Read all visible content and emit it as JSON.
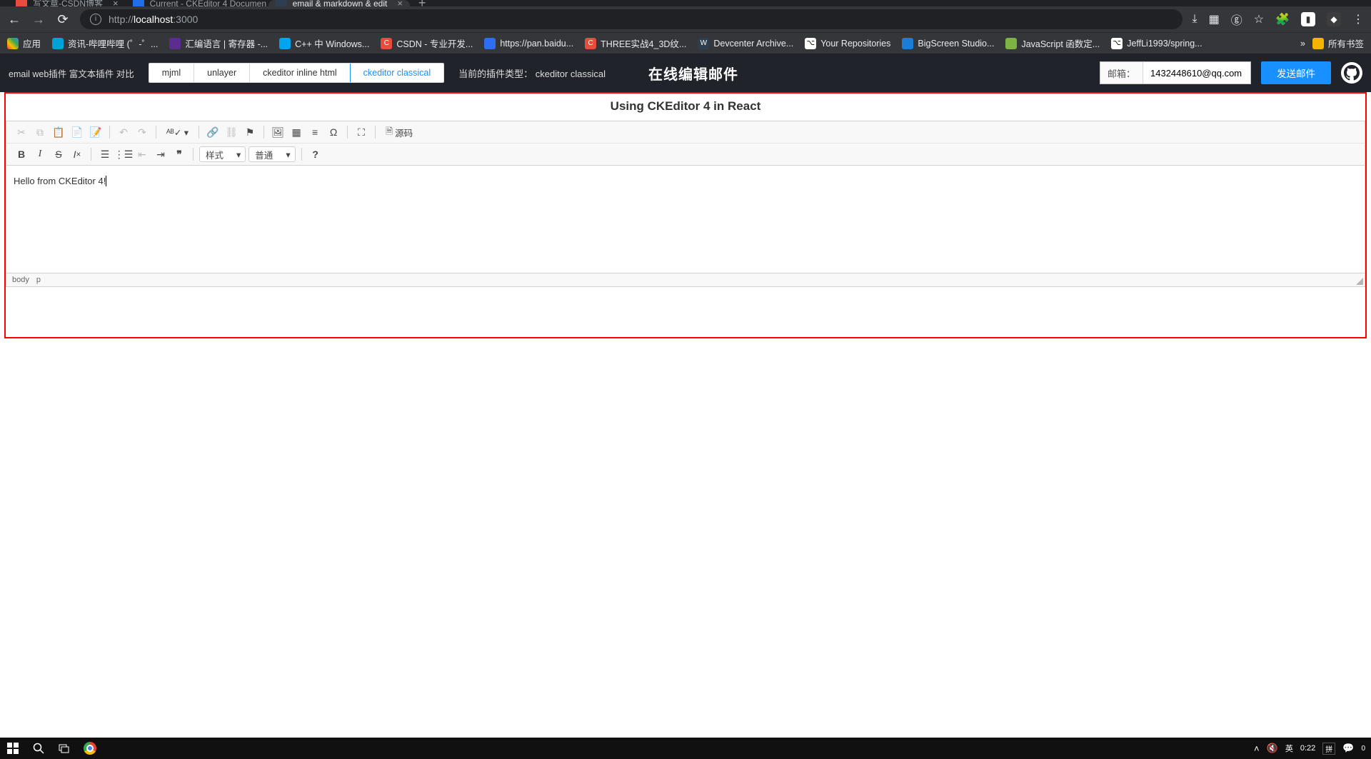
{
  "browser": {
    "tabs": [
      {
        "title": "写文章-CSDN博客",
        "favicon": "#e74c3c"
      },
      {
        "title": "Current - CKEditor 4 Documen",
        "favicon": "#1f6feb"
      },
      {
        "title": "email & markdown & edit",
        "favicon": "#2c3e50"
      }
    ],
    "activeTab": 2,
    "url_proto": "http://",
    "url_host": "localhost",
    "url_port": ":3000"
  },
  "bookmarks": {
    "apps": "应用",
    "items": [
      {
        "label": "资讯-哔哩哔哩 (゜-゜...",
        "color": "#00a1d6"
      },
      {
        "label": "汇编语言 | 寄存器 -...",
        "color": "#5c2d91"
      },
      {
        "label": "C++ 中 Windows...",
        "color": "#00a4ef"
      },
      {
        "label": "CSDN - 专业开发...",
        "color": "#e74c3c"
      },
      {
        "label": "https://pan.baidu...",
        "color": "#2e6ff2"
      },
      {
        "label": "THREE实战4_3D纹...",
        "color": "#e74c3c"
      },
      {
        "label": "Devcenter Archive...",
        "color": "#2c3e50"
      },
      {
        "label": "Your Repositories",
        "color": "#ffffff"
      },
      {
        "label": "BigScreen Studio...",
        "color": "#1d7dd4"
      },
      {
        "label": "JavaScript 函数定...",
        "color": "#7cb342"
      },
      {
        "label": "JeffLi1993/spring...",
        "color": "#ffffff"
      }
    ],
    "more": "»",
    "allFolder": "所有书签"
  },
  "app": {
    "leftLabel": "email web插件 富文本插件 对比",
    "pluginTabs": [
      "mjml",
      "unlayer",
      "ckeditor inline html",
      "ckeditor classical"
    ],
    "activePluginTab": 3,
    "currentTypeLabel": "当前的插件类型：",
    "currentTypeValue": "ckeditor classical",
    "title": "在线编辑邮件",
    "emailLabel": "邮箱：",
    "emailValue": "1432448610@qq.com",
    "sendLabel": "发送邮件"
  },
  "editor": {
    "heading": "Using CKEditor 4 in React",
    "sourceBtn": "源码",
    "styleCombo": "样式",
    "formatCombo": "普通",
    "content": "Hello from CKEditor 4!",
    "path1": "body",
    "path2": "p"
  },
  "taskbar": {
    "ime1": "英",
    "time": "0:22",
    "date": "拼",
    "notif": "0"
  }
}
